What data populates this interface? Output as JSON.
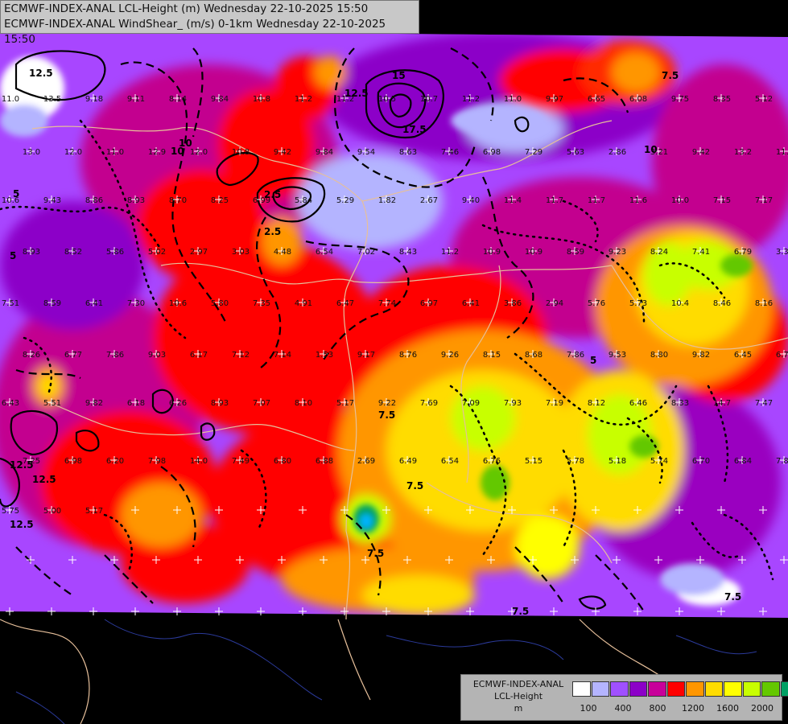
{
  "header": {
    "line1": "ECMWF-INDEX-ANAL LCL-Height (m) Wednesday 22-10-2025 15:50",
    "line2": "ECMWF-INDEX-ANAL WindShear_ (m/s) 0-1km Wednesday 22-10-2025 15:50"
  },
  "legend": {
    "line1": "ECMWF-INDEX-ANAL",
    "line2": "LCL-Height",
    "line3": "m",
    "colors": [
      "#ffffff",
      "#b4b4ff",
      "#a050ff",
      "#8c00c8",
      "#c8009a",
      "#ff0000",
      "#ff9600",
      "#ffdc00",
      "#ffff00",
      "#c8ff00",
      "#64c800",
      "#00a064",
      "#00b4ff"
    ],
    "ticks": [
      "100",
      "400",
      "800",
      "1200",
      "1600",
      "2000"
    ]
  },
  "station_values": [
    "11.0",
    "13.5",
    "9.18",
    "9.11",
    "8.14",
    "9.84",
    "10.8",
    "11.2",
    "11.2",
    "10.5",
    "10.7",
    "11.2",
    "11.0",
    "9.97",
    "6.65",
    "6.08",
    "9.75",
    "8.35",
    "5.12",
    "13.0",
    "12.0",
    "11.0",
    "12.9",
    "12.0",
    "10.8",
    "9.42",
    "9.84",
    "9.54",
    "8.63",
    "7.46",
    "6.98",
    "7.29",
    "5.63",
    "2.86",
    "3.21",
    "9.42",
    "13.2",
    "11.4",
    "10.6",
    "9.43",
    "8.86",
    "8.93",
    "8.70",
    "8.25",
    "6.99",
    "5.84",
    "5.29",
    "1.82",
    "2.67",
    "9.40",
    "11.4",
    "11.7",
    "11.7",
    "11.6",
    "10.0",
    "7.15",
    "7.17",
    "8.93",
    "8.52",
    "5.86",
    "5.02",
    "2.97",
    "3.03",
    "4.48",
    "6.54",
    "7.02",
    "8.43",
    "11.2",
    "10.9",
    "10.9",
    "8.59",
    "9.23",
    "8.24",
    "7.41",
    "6.79",
    "3.31",
    "7.51",
    "8.59",
    "6.41",
    "7.30",
    "10.6",
    "5.80",
    "7.35",
    "4.91",
    "6.47",
    "7.74",
    "6.97",
    "6.41",
    "3.86",
    "2.94",
    "5.76",
    "5.73",
    "10.4",
    "8.46",
    "8.16",
    "8.26",
    "6.77",
    "7.86",
    "9.03",
    "6.17",
    "7.12",
    "7.14",
    "1.53",
    "9.17",
    "8.76",
    "9.26",
    "8.15",
    "8.68",
    "7.86",
    "9.53",
    "8.80",
    "9.82",
    "6.45",
    "6.76",
    "6.43",
    "5.51",
    "9.82",
    "6.18",
    "6.26",
    "8.93",
    "7.07",
    "8.10",
    "5.17",
    "9.22",
    "7.69",
    "7.09",
    "7.93",
    "7.19",
    "8.12",
    "6.46",
    "8.33",
    "14.7",
    "7.47",
    "7.25",
    "6.98",
    "6.20",
    "7.98",
    "14.0",
    "7.49",
    "6.80",
    "6.88",
    "2.69",
    "6.49",
    "6.54",
    "6.76",
    "5.15",
    "5.78",
    "5.18",
    "5.74",
    "6.70",
    "6.84",
    "7.84",
    "5.75",
    "5.00",
    "5.17"
  ],
  "contour_labels": [
    "12.5",
    "17.5",
    "15",
    "12.5",
    "10",
    "10",
    "10",
    "12.5",
    "7.5",
    "7.5",
    "7.5",
    "7.5",
    "5",
    "5",
    "5",
    "2.5",
    "2.5",
    "12.5",
    "12.5",
    "7.5",
    "7.5"
  ]
}
